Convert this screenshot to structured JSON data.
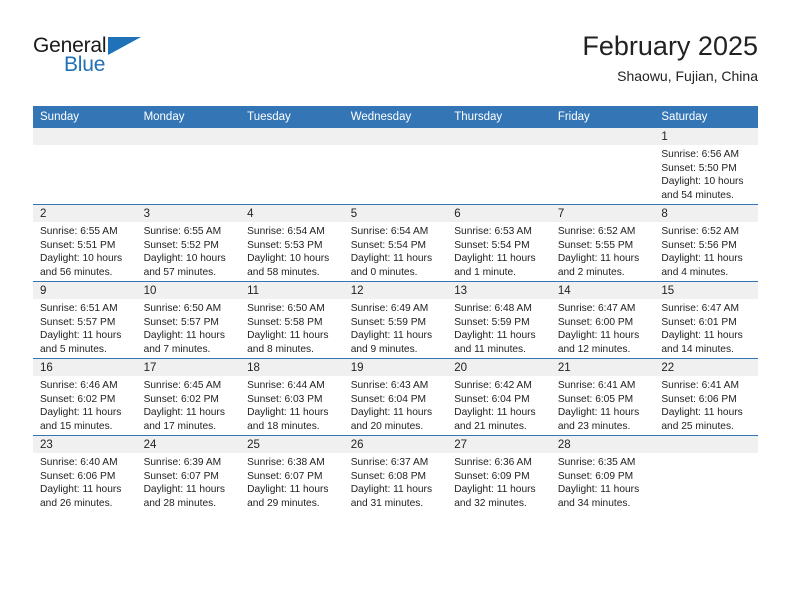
{
  "brand": {
    "word_one": "General",
    "word_two": "Blue",
    "triangle_icon": "brand-triangle-icon"
  },
  "header": {
    "month_title": "February 2025",
    "location": "Shaowu, Fujian, China"
  },
  "colors": {
    "header_blue": "#3476b5",
    "brand_blue": "#2072b8",
    "daynum_band": "#f0f0f0",
    "text": "#222222"
  },
  "calendar": {
    "weekday_headers": [
      "Sunday",
      "Monday",
      "Tuesday",
      "Wednesday",
      "Thursday",
      "Friday",
      "Saturday"
    ],
    "labels": {
      "sunrise": "Sunrise:",
      "sunset": "Sunset:",
      "daylight": "Daylight:"
    },
    "weeks": [
      [
        {
          "day": "",
          "sunrise": "",
          "sunset": "",
          "daylight": "",
          "empty": true
        },
        {
          "day": "",
          "sunrise": "",
          "sunset": "",
          "daylight": "",
          "empty": true
        },
        {
          "day": "",
          "sunrise": "",
          "sunset": "",
          "daylight": "",
          "empty": true
        },
        {
          "day": "",
          "sunrise": "",
          "sunset": "",
          "daylight": "",
          "empty": true
        },
        {
          "day": "",
          "sunrise": "",
          "sunset": "",
          "daylight": "",
          "empty": true
        },
        {
          "day": "",
          "sunrise": "",
          "sunset": "",
          "daylight": "",
          "empty": true
        },
        {
          "day": "1",
          "sunrise": "Sunrise: 6:56 AM",
          "sunset": "Sunset: 5:50 PM",
          "daylight": "Daylight: 10 hours and 54 minutes.",
          "empty": false
        }
      ],
      [
        {
          "day": "2",
          "sunrise": "Sunrise: 6:55 AM",
          "sunset": "Sunset: 5:51 PM",
          "daylight": "Daylight: 10 hours and 56 minutes.",
          "empty": false
        },
        {
          "day": "3",
          "sunrise": "Sunrise: 6:55 AM",
          "sunset": "Sunset: 5:52 PM",
          "daylight": "Daylight: 10 hours and 57 minutes.",
          "empty": false
        },
        {
          "day": "4",
          "sunrise": "Sunrise: 6:54 AM",
          "sunset": "Sunset: 5:53 PM",
          "daylight": "Daylight: 10 hours and 58 minutes.",
          "empty": false
        },
        {
          "day": "5",
          "sunrise": "Sunrise: 6:54 AM",
          "sunset": "Sunset: 5:54 PM",
          "daylight": "Daylight: 11 hours and 0 minutes.",
          "empty": false
        },
        {
          "day": "6",
          "sunrise": "Sunrise: 6:53 AM",
          "sunset": "Sunset: 5:54 PM",
          "daylight": "Daylight: 11 hours and 1 minute.",
          "empty": false
        },
        {
          "day": "7",
          "sunrise": "Sunrise: 6:52 AM",
          "sunset": "Sunset: 5:55 PM",
          "daylight": "Daylight: 11 hours and 2 minutes.",
          "empty": false
        },
        {
          "day": "8",
          "sunrise": "Sunrise: 6:52 AM",
          "sunset": "Sunset: 5:56 PM",
          "daylight": "Daylight: 11 hours and 4 minutes.",
          "empty": false
        }
      ],
      [
        {
          "day": "9",
          "sunrise": "Sunrise: 6:51 AM",
          "sunset": "Sunset: 5:57 PM",
          "daylight": "Daylight: 11 hours and 5 minutes.",
          "empty": false
        },
        {
          "day": "10",
          "sunrise": "Sunrise: 6:50 AM",
          "sunset": "Sunset: 5:57 PM",
          "daylight": "Daylight: 11 hours and 7 minutes.",
          "empty": false
        },
        {
          "day": "11",
          "sunrise": "Sunrise: 6:50 AM",
          "sunset": "Sunset: 5:58 PM",
          "daylight": "Daylight: 11 hours and 8 minutes.",
          "empty": false
        },
        {
          "day": "12",
          "sunrise": "Sunrise: 6:49 AM",
          "sunset": "Sunset: 5:59 PM",
          "daylight": "Daylight: 11 hours and 9 minutes.",
          "empty": false
        },
        {
          "day": "13",
          "sunrise": "Sunrise: 6:48 AM",
          "sunset": "Sunset: 5:59 PM",
          "daylight": "Daylight: 11 hours and 11 minutes.",
          "empty": false
        },
        {
          "day": "14",
          "sunrise": "Sunrise: 6:47 AM",
          "sunset": "Sunset: 6:00 PM",
          "daylight": "Daylight: 11 hours and 12 minutes.",
          "empty": false
        },
        {
          "day": "15",
          "sunrise": "Sunrise: 6:47 AM",
          "sunset": "Sunset: 6:01 PM",
          "daylight": "Daylight: 11 hours and 14 minutes.",
          "empty": false
        }
      ],
      [
        {
          "day": "16",
          "sunrise": "Sunrise: 6:46 AM",
          "sunset": "Sunset: 6:02 PM",
          "daylight": "Daylight: 11 hours and 15 minutes.",
          "empty": false
        },
        {
          "day": "17",
          "sunrise": "Sunrise: 6:45 AM",
          "sunset": "Sunset: 6:02 PM",
          "daylight": "Daylight: 11 hours and 17 minutes.",
          "empty": false
        },
        {
          "day": "18",
          "sunrise": "Sunrise: 6:44 AM",
          "sunset": "Sunset: 6:03 PM",
          "daylight": "Daylight: 11 hours and 18 minutes.",
          "empty": false
        },
        {
          "day": "19",
          "sunrise": "Sunrise: 6:43 AM",
          "sunset": "Sunset: 6:04 PM",
          "daylight": "Daylight: 11 hours and 20 minutes.",
          "empty": false
        },
        {
          "day": "20",
          "sunrise": "Sunrise: 6:42 AM",
          "sunset": "Sunset: 6:04 PM",
          "daylight": "Daylight: 11 hours and 21 minutes.",
          "empty": false
        },
        {
          "day": "21",
          "sunrise": "Sunrise: 6:41 AM",
          "sunset": "Sunset: 6:05 PM",
          "daylight": "Daylight: 11 hours and 23 minutes.",
          "empty": false
        },
        {
          "day": "22",
          "sunrise": "Sunrise: 6:41 AM",
          "sunset": "Sunset: 6:06 PM",
          "daylight": "Daylight: 11 hours and 25 minutes.",
          "empty": false
        }
      ],
      [
        {
          "day": "23",
          "sunrise": "Sunrise: 6:40 AM",
          "sunset": "Sunset: 6:06 PM",
          "daylight": "Daylight: 11 hours and 26 minutes.",
          "empty": false
        },
        {
          "day": "24",
          "sunrise": "Sunrise: 6:39 AM",
          "sunset": "Sunset: 6:07 PM",
          "daylight": "Daylight: 11 hours and 28 minutes.",
          "empty": false
        },
        {
          "day": "25",
          "sunrise": "Sunrise: 6:38 AM",
          "sunset": "Sunset: 6:07 PM",
          "daylight": "Daylight: 11 hours and 29 minutes.",
          "empty": false
        },
        {
          "day": "26",
          "sunrise": "Sunrise: 6:37 AM",
          "sunset": "Sunset: 6:08 PM",
          "daylight": "Daylight: 11 hours and 31 minutes.",
          "empty": false
        },
        {
          "day": "27",
          "sunrise": "Sunrise: 6:36 AM",
          "sunset": "Sunset: 6:09 PM",
          "daylight": "Daylight: 11 hours and 32 minutes.",
          "empty": false
        },
        {
          "day": "28",
          "sunrise": "Sunrise: 6:35 AM",
          "sunset": "Sunset: 6:09 PM",
          "daylight": "Daylight: 11 hours and 34 minutes.",
          "empty": false
        },
        {
          "day": "",
          "sunrise": "",
          "sunset": "",
          "daylight": "",
          "empty": true
        }
      ]
    ]
  }
}
